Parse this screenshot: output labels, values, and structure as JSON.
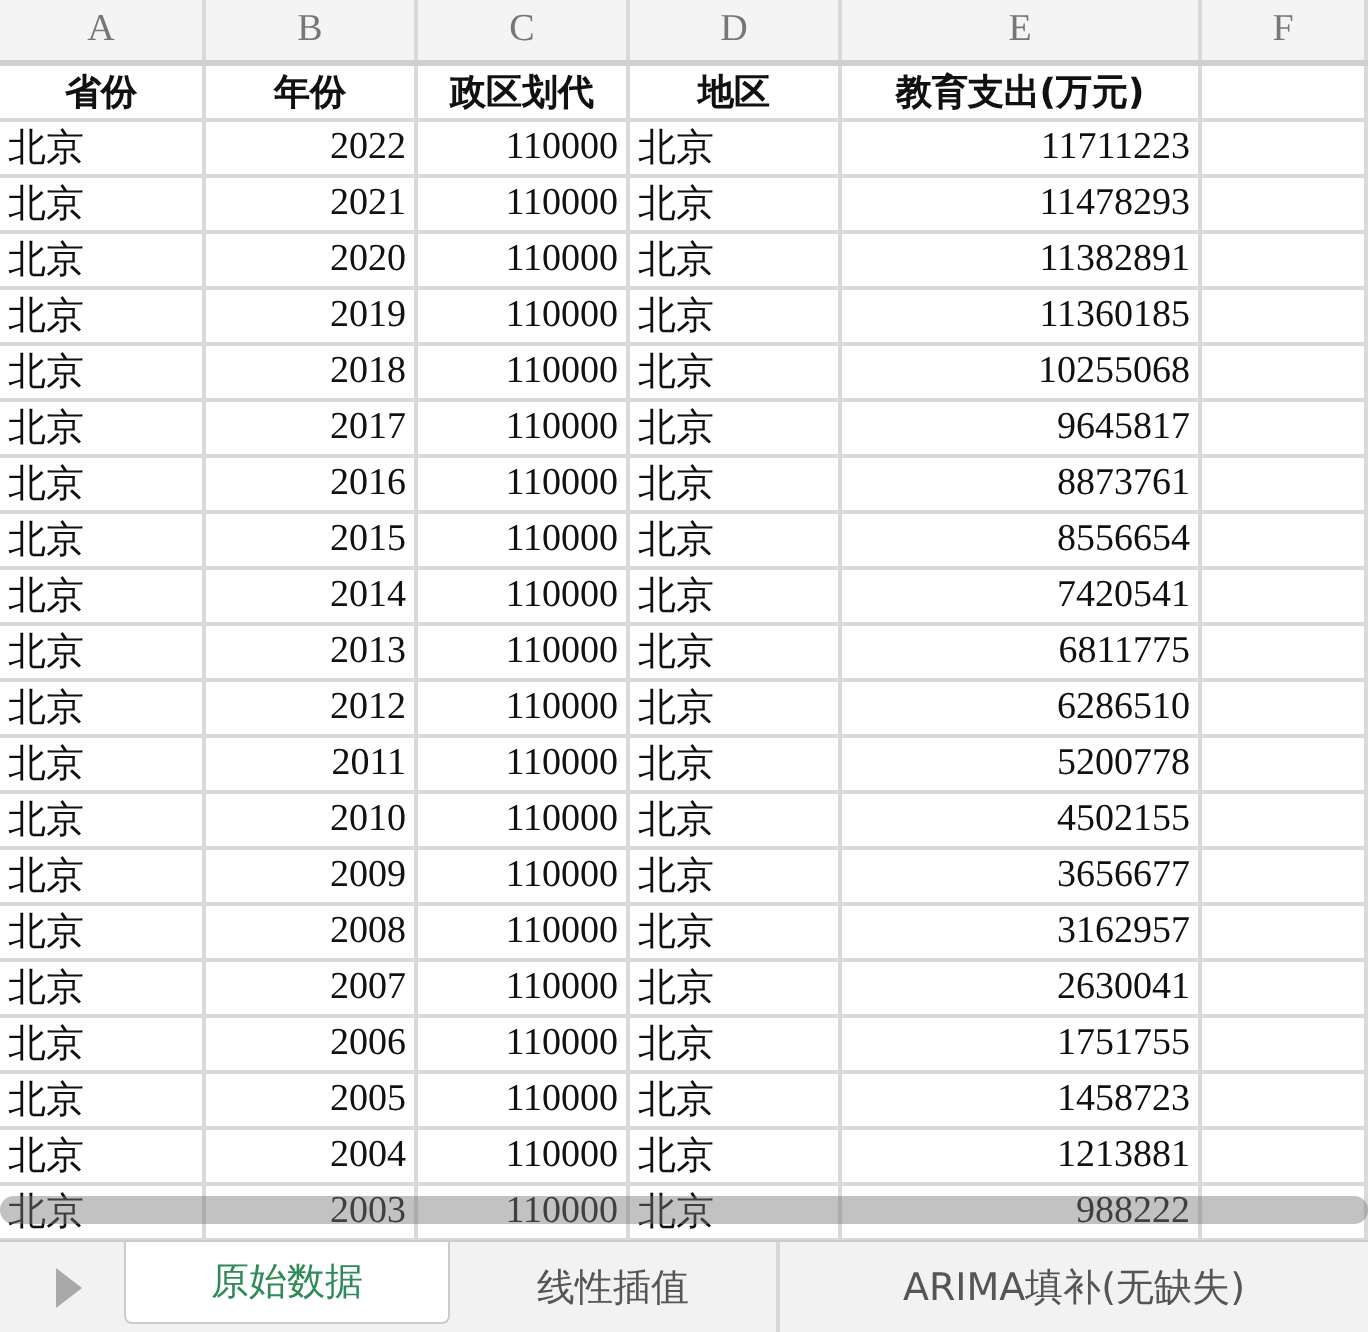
{
  "columns": [
    "A",
    "B",
    "C",
    "D",
    "E",
    "F"
  ],
  "header_row": [
    "省份",
    "年份",
    "政区划代",
    "地区",
    "教育支出(万元)"
  ],
  "rows": [
    [
      "北京",
      "2022",
      "110000",
      "北京",
      "11711223"
    ],
    [
      "北京",
      "2021",
      "110000",
      "北京",
      "11478293"
    ],
    [
      "北京",
      "2020",
      "110000",
      "北京",
      "11382891"
    ],
    [
      "北京",
      "2019",
      "110000",
      "北京",
      "11360185"
    ],
    [
      "北京",
      "2018",
      "110000",
      "北京",
      "10255068"
    ],
    [
      "北京",
      "2017",
      "110000",
      "北京",
      "9645817"
    ],
    [
      "北京",
      "2016",
      "110000",
      "北京",
      "8873761"
    ],
    [
      "北京",
      "2015",
      "110000",
      "北京",
      "8556654"
    ],
    [
      "北京",
      "2014",
      "110000",
      "北京",
      "7420541"
    ],
    [
      "北京",
      "2013",
      "110000",
      "北京",
      "6811775"
    ],
    [
      "北京",
      "2012",
      "110000",
      "北京",
      "6286510"
    ],
    [
      "北京",
      "2011",
      "110000",
      "北京",
      "5200778"
    ],
    [
      "北京",
      "2010",
      "110000",
      "北京",
      "4502155"
    ],
    [
      "北京",
      "2009",
      "110000",
      "北京",
      "3656677"
    ],
    [
      "北京",
      "2008",
      "110000",
      "北京",
      "3162957"
    ],
    [
      "北京",
      "2007",
      "110000",
      "北京",
      "2630041"
    ],
    [
      "北京",
      "2006",
      "110000",
      "北京",
      "1751755"
    ],
    [
      "北京",
      "2005",
      "110000",
      "北京",
      "1458723"
    ],
    [
      "北京",
      "2004",
      "110000",
      "北京",
      "1213881"
    ],
    [
      "北京",
      "2003",
      "110000",
      "北京",
      "988222"
    ]
  ],
  "sheet_tabs": [
    {
      "label": "原始数据",
      "selected": true
    },
    {
      "label": "线性插值",
      "selected": false
    },
    {
      "label": "ARIMA填补(无缺失)",
      "selected": false
    }
  ]
}
